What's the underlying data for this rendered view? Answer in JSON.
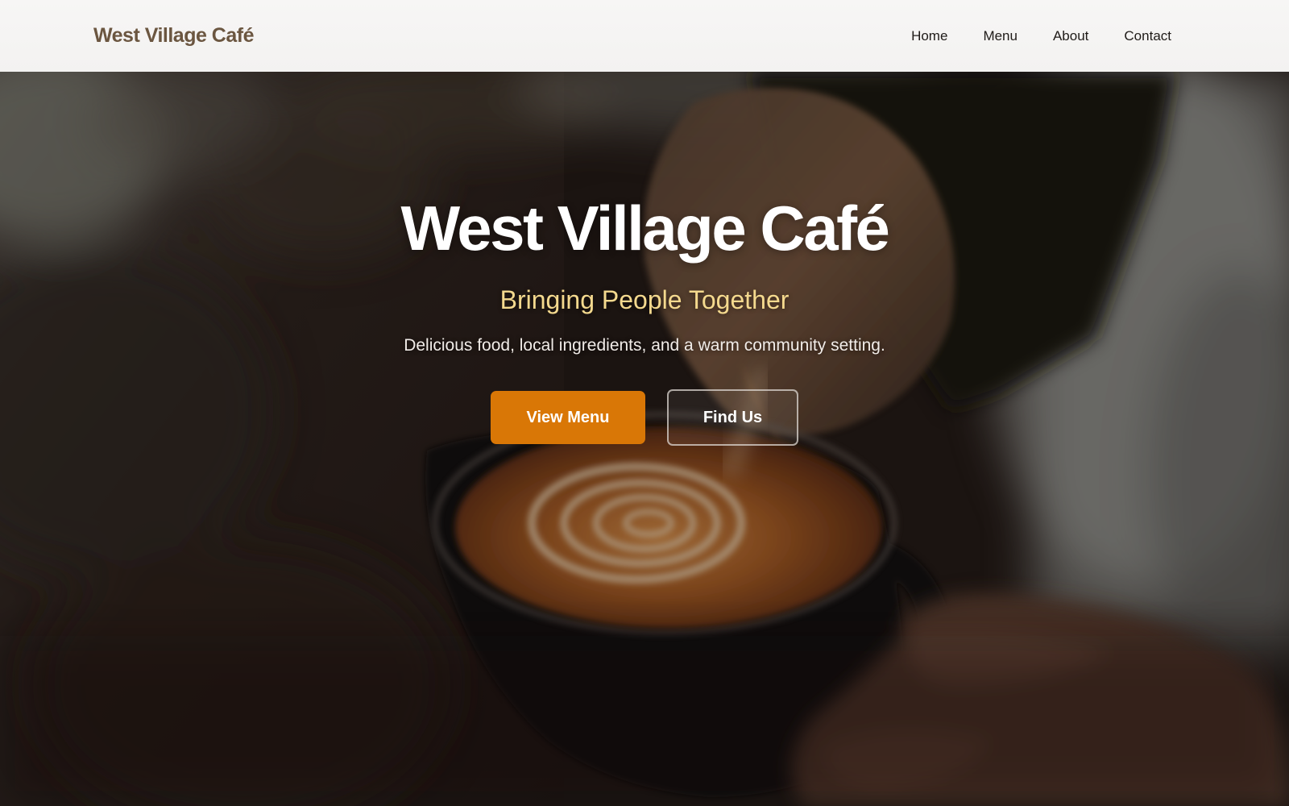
{
  "header": {
    "brand": "West Village Café",
    "nav": [
      {
        "label": "Home"
      },
      {
        "label": "Menu"
      },
      {
        "label": "About"
      },
      {
        "label": "Contact"
      }
    ]
  },
  "hero": {
    "background_image": "latte-art-pour-photo",
    "title": "West Village Café",
    "subtitle": "Bringing People Together",
    "tagline": "Delicious food, local ingredients, and a warm community setting.",
    "primary_button": "View Menu",
    "secondary_button": "Find Us"
  },
  "colors": {
    "brand": "#6b5640",
    "accent": "#d97706",
    "subtitle": "#f4d98e",
    "header_bg": "#f5f4f3"
  }
}
